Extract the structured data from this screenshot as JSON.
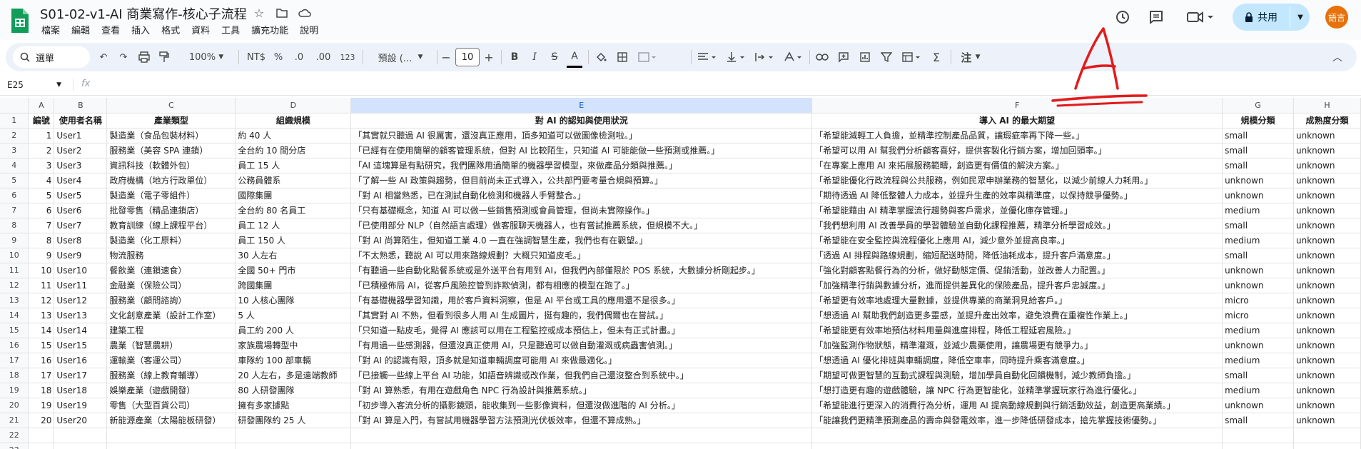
{
  "app": {
    "title": "S01-02-v1-AI 商業寫作-核心子流程",
    "menu": [
      "檔案",
      "編輯",
      "查看",
      "插入",
      "格式",
      "資料",
      "工具",
      "擴充功能",
      "說明"
    ],
    "share_label": "共用",
    "avatar_text": "語言"
  },
  "toolbar": {
    "search_label": "選單",
    "zoom": "100%",
    "currency": "NT$",
    "percent": "%",
    "dec_decrease": ".0",
    "dec_increase": ".00",
    "number_format": "123",
    "font": "預設 (...",
    "font_size": "10",
    "bold": "B",
    "italic": "I",
    "strike": "S",
    "text_color": "A",
    "more_label": "注"
  },
  "formula_bar": {
    "name_box": "E25",
    "fx": "fx",
    "value": ""
  },
  "annotation": {
    "letter": "A",
    "color": "#e21b1b"
  },
  "sheet": {
    "columns": [
      "A",
      "B",
      "C",
      "D",
      "E",
      "F",
      "G",
      "H"
    ],
    "selected_column": "E",
    "header_row": [
      "編號",
      "使用者名稱",
      "產業類型",
      "組織規模",
      "對 AI 的認知與使用狀況",
      "導入 AI 的最大期望",
      "規模分類",
      "成熟度分類"
    ],
    "rows": [
      [
        "1",
        "User1",
        "製造業（食品包裝材料）",
        "約 40 人",
        "「其實就只聽過 AI 很厲害，還沒真正應用，頂多知道可以做圖像檢測啦。」",
        "「希望能減輕工人負擔，並精準控制產品品質，讓瑕疵率再下降一些。」",
        "small",
        "unknown"
      ],
      [
        "2",
        "User2",
        "服務業（美容 SPA 連鎖）",
        "全台約 10 間分店",
        "「已經有在使用簡單的顧客管理系統，但對 AI 比較陌生，只知道 AI 可能能做一些預測或推薦。」",
        "「希望可以用 AI 幫我們分析顧客喜好，提供客製化行銷方案，增加回頭率。」",
        "small",
        "unknown"
      ],
      [
        "3",
        "User3",
        "資訊科技（軟體外包）",
        "員工 15 人",
        "「AI 這塊算是有點研究，我們團隊用過簡單的機器學習模型，來做產品分類與推薦。」",
        "「在專案上應用 AI 來拓展服務範疇，創造更有價值的解決方案。」",
        "small",
        "unknown"
      ],
      [
        "4",
        "User4",
        "政府機構（地方行政單位）",
        "公務員體系",
        "「了解一些 AI 政策與趨勢，但目前尚未正式導入，公共部門要考量合規與預算。」",
        "「希望能優化行政流程與公共服務，例如民眾申辦業務的智慧化，以減少前線人力耗用。」",
        "unknown",
        "unknown"
      ],
      [
        "5",
        "User5",
        "製造業（電子零組件）",
        "國際集團",
        "「對 AI 相當熟悉，已在測試自動化檢測和機器人手臂整合。」",
        "「期待透過 AI 降低整體人力成本，並提升生產的效率與精準度，以保持競爭優勢。」",
        "unknown",
        "unknown"
      ],
      [
        "6",
        "User6",
        "批發零售（精品連鎖店）",
        "全台約 80 名員工",
        "「只有基礎概念，知道 AI 可以做一些銷售預測或會員管理，但尚未實際操作。」",
        "「希望能藉由 AI 精準掌握流行趨勢與客戶需求，並優化庫存管理。」",
        "medium",
        "unknown"
      ],
      [
        "7",
        "User7",
        "教育訓練（線上課程平台）",
        "員工 12 人",
        "「已使用部分 NLP（自然語言處理）做客服聊天機器人，也有嘗試推薦系統，但規模不大。」",
        "「我們想利用 AI 改善學員的學習體驗並自動化課程推薦，精準分析學習成效。」",
        "small",
        "unknown"
      ],
      [
        "8",
        "User8",
        "製造業（化工原料）",
        "員工 150 人",
        "「對 AI 尚算陌生，但知道工業 4.0 一直在強調智慧生產，我們也有在觀望。」",
        "「希望能在安全監控與流程優化上應用 AI，減少意外並提高良率。」",
        "medium",
        "unknown"
      ],
      [
        "9",
        "User9",
        "物流服務",
        "30 人左右",
        "「不太熟悉，聽說 AI 可以用來路線規劃？大概只知道皮毛。」",
        "「透過 AI 排程與路線規劃，縮短配送時間，降低油耗成本，提升客戶滿意度。」",
        "small",
        "unknown"
      ],
      [
        "10",
        "User10",
        "餐飲業（連鎖速食）",
        "全國 50+ 門市",
        "「有聽過一些自動化點餐系統或是外送平台有用到 AI，但我們內部僅限於 POS 系統，大數據分析剛起步。」",
        "「強化對顧客點餐行為的分析，做好動態定價、促銷活動，並改善人力配置。」",
        "unknown",
        "unknown"
      ],
      [
        "11",
        "User11",
        "金融業（保險公司）",
        "跨國集團",
        "「已積極佈局 AI，從客戶風險控管到詐欺偵測，都有相應的模型在跑了。」",
        "「加強精準行銷與數據分析，進而提供差異化的保險產品，提升客戶忠誠度。」",
        "unknown",
        "unknown"
      ],
      [
        "12",
        "User12",
        "服務業（顧問諮詢）",
        "10 人核心團隊",
        "「有基礎機器學習知識，用於客戶資料洞察，但是 AI 平台或工具的應用還不是很多。」",
        "「希望更有效率地處理大量數據，並提供專業的商業洞見給客戶。」",
        "micro",
        "unknown"
      ],
      [
        "13",
        "User13",
        "文化創意產業（設計工作室）",
        "5 人",
        "「其實對 AI 不熟，但看到很多人用 AI 生成圖片，挺有趣的，我們偶爾也在嘗試。」",
        "「想透過 AI 幫助我們創造更多靈感，並提升產出效率，避免浪費在重複性作業上。」",
        "micro",
        "unknown"
      ],
      [
        "14",
        "User14",
        "建築工程",
        "員工約 200 人",
        "「只知道一點皮毛，覺得 AI 應該可以用在工程監控或成本預估上，但未有正式計畫。」",
        "「希望能更有效率地預估材料用量與進度排程，降低工程延宕風險。」",
        "medium",
        "unknown"
      ],
      [
        "15",
        "User15",
        "農業（智慧農耕）",
        "家族農場轉型中",
        "「有用過一些感測器，但還沒真正使用 AI，只是聽過可以做自動灌溉或病蟲害偵測。」",
        "「加強監測作物狀態，精準灌溉，並減少農藥使用，讓農場更有競爭力。」",
        "unknown",
        "unknown"
      ],
      [
        "16",
        "User16",
        "運輸業（客運公司）",
        "車隊約 100 部車輛",
        "「對 AI 的認識有限，頂多就是知道車輛調度可能用 AI 來做最適化。」",
        "「想透過 AI 優化排班與車輛調度，降低空車率，同時提升乘客滿意度。」",
        "medium",
        "unknown"
      ],
      [
        "17",
        "User17",
        "服務業（線上教育輔導）",
        "20 人左右，多是遠端教師",
        "「已接觸一些線上平台 AI 功能，如語音辨識或改作業，但我們自己還沒整合到系統中。」",
        "「期望可做更智慧的互動式課程與測驗，增加學員自動化回饋機制，減少教師負擔。」",
        "small",
        "unknown"
      ],
      [
        "18",
        "User18",
        "娛樂產業（遊戲開發）",
        "80 人研發團隊",
        "「對 AI 算熟悉，有用在遊戲角色 NPC 行為設計與推薦系統。」",
        "「想打造更有趣的遊戲體驗，讓 NPC 行為更智能化，並精準掌握玩家行為進行優化。」",
        "medium",
        "unknown"
      ],
      [
        "19",
        "User19",
        "零售（大型百貨公司）",
        "擁有多家據點",
        "「初步導入客流分析的攝影鏡頭，能收集到一些影像資料，但還沒做進階的 AI 分析。」",
        "「希望能進行更深入的消費行為分析，運用 AI 提高動線規劃與行銷活動效益，創造更高業績。」",
        "unknown",
        "unknown"
      ],
      [
        "20",
        "User20",
        "新能源產業（太陽能板研發）",
        "研發團隊約 25 人",
        "「對 AI 算是入門，有嘗試用機器學習方法預測光伏板效率，但還不算成熟。」",
        "「能讓我們更精準預測產品的壽命與發電效率，進一步降低研發成本，搶先掌握技術優勢。」",
        "small",
        "unknown"
      ]
    ]
  }
}
